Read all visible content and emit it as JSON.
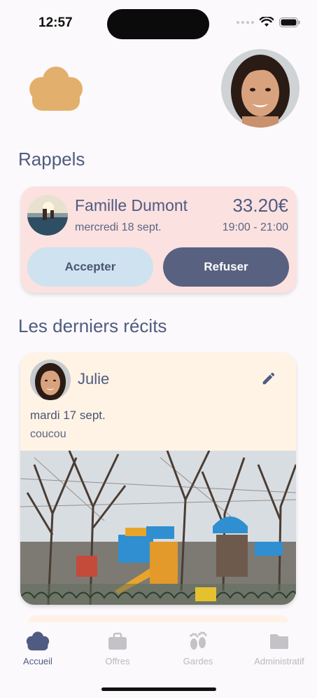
{
  "status_bar": {
    "time": "12:57"
  },
  "reminders": {
    "title": "Rappels",
    "card": {
      "family": "Famille Dumont",
      "date": "mercredi 18 sept.",
      "price": "33.20€",
      "hours": "19:00 - 21:00",
      "accept_label": "Accepter",
      "refuse_label": "Refuser"
    }
  },
  "stories": {
    "title": "Les derniers récits",
    "items": [
      {
        "author": "Julie",
        "date": "mardi 17 sept.",
        "text": "coucou"
      }
    ]
  },
  "tabs": [
    {
      "label": "Accueil",
      "active": true
    },
    {
      "label": "Offres",
      "active": false
    },
    {
      "label": "Gardes",
      "active": false
    },
    {
      "label": "Administratif",
      "active": false
    }
  ],
  "colors": {
    "accent": "#4f5b80",
    "reminder_bg": "#fbe1e0",
    "story_bg": "#fff3e5",
    "accept_bg": "#cfe2ef",
    "refuse_bg": "#596180",
    "logo": "#e2b06c"
  }
}
